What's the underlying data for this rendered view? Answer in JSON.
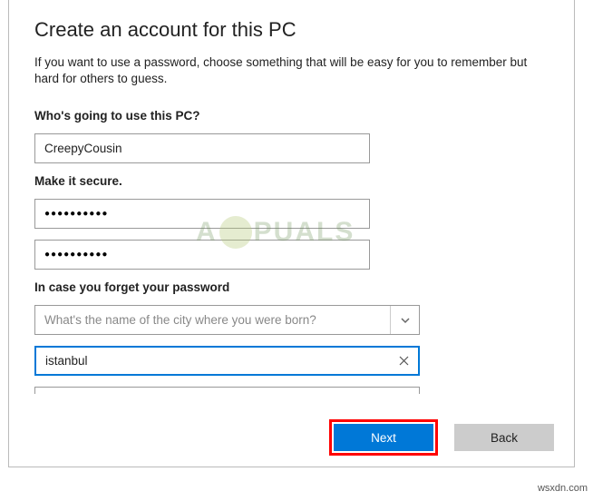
{
  "title": "Create an account for this PC",
  "description": "If you want to use a password, choose something that will be easy for you to remember but hard for others to guess.",
  "section1": {
    "label": "Who's going to use this PC?",
    "username": "CreepyCousin"
  },
  "section2": {
    "label": "Make it secure.",
    "password1_mask": "●●●●●●●●●●",
    "password2_mask": "●●●●●●●●●●"
  },
  "section3": {
    "label": "In case you forget your password",
    "question_selected": "What's the name of the city where you were born?",
    "answer": "istanbul"
  },
  "buttons": {
    "next": "Next",
    "back": "Back"
  },
  "watermark_site": "wsxdn.com",
  "watermark_brand_left": "A",
  "watermark_brand_right": "PUALS"
}
